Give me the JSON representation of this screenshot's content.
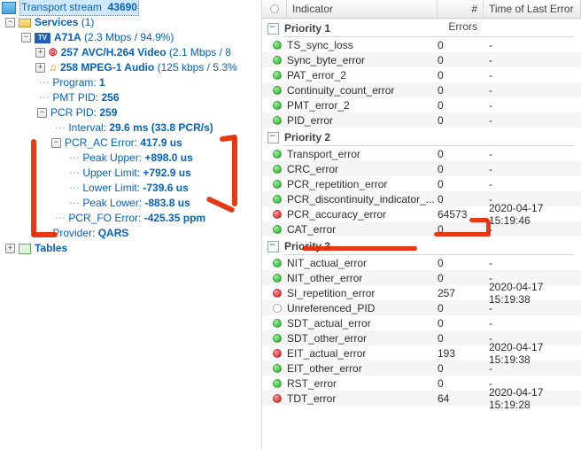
{
  "tree": {
    "transport_stream": {
      "label": "Transport stream",
      "id": "43690"
    },
    "services": {
      "label": "Services",
      "count": "(1)"
    },
    "channel": {
      "icon_text": "TV",
      "name": "A71A",
      "stats": "(2.3 Mbps / 94.9%)"
    },
    "video": {
      "pid": "257",
      "label": "AVC/H.264 Video",
      "stats": "(2.1 Mbps / 8"
    },
    "audio": {
      "pid": "258",
      "label": "MPEG-1 Audio",
      "stats": "(125 kbps / 5.3%"
    },
    "program": {
      "label": "Program:",
      "value": "1"
    },
    "pmt": {
      "label": "PMT PID:",
      "value": "256"
    },
    "pcr": {
      "label": "PCR PID:",
      "value": "259"
    },
    "interval": {
      "label": "Interval:",
      "value": "29.6 ms (33.8 PCR/s)"
    },
    "pcr_ac": {
      "label": "PCR_AC Error:",
      "value": "417.9 us"
    },
    "peak_upper": {
      "label": "Peak Upper:",
      "value": "+898.0 us"
    },
    "upper_limit": {
      "label": "Upper Limit:",
      "value": "+792.9 us"
    },
    "lower_limit": {
      "label": "Lower Limit:",
      "value": "-739.6 us"
    },
    "peak_lower": {
      "label": "Peak Lower:",
      "value": "-883.8 us"
    },
    "pcr_fo": {
      "label": "PCR_FO Error:",
      "value": "-425.35 ppm"
    },
    "provider": {
      "label": "Provider:",
      "value": "QARS"
    },
    "tables": {
      "label": "Tables"
    }
  },
  "table": {
    "headers": {
      "indicator": "Indicator",
      "errors": "# Errors",
      "time": "Time of Last Error"
    },
    "groups": [
      {
        "title": "Priority 1",
        "rows": [
          {
            "status": "green",
            "name": "TS_sync_loss",
            "errors": "0",
            "time": "-"
          },
          {
            "status": "green",
            "name": "Sync_byte_error",
            "errors": "0",
            "time": "-"
          },
          {
            "status": "green",
            "name": "PAT_error_2",
            "errors": "0",
            "time": "-"
          },
          {
            "status": "green",
            "name": "Continuity_count_error",
            "errors": "0",
            "time": "-"
          },
          {
            "status": "green",
            "name": "PMT_error_2",
            "errors": "0",
            "time": "-"
          },
          {
            "status": "green",
            "name": "PID_error",
            "errors": "0",
            "time": "-"
          }
        ]
      },
      {
        "title": "Priority 2",
        "rows": [
          {
            "status": "green",
            "name": "Transport_error",
            "errors": "0",
            "time": "-"
          },
          {
            "status": "green",
            "name": "CRC_error",
            "errors": "0",
            "time": "-"
          },
          {
            "status": "green",
            "name": "PCR_repetition_error",
            "errors": "0",
            "time": "-"
          },
          {
            "status": "green",
            "name": "PCR_discontinuity_indicator_...",
            "errors": "0",
            "time": "-"
          },
          {
            "status": "red",
            "name": "PCR_accuracy_error",
            "errors": "64573",
            "time": "2020-04-17 15:19:46"
          },
          {
            "status": "green",
            "name": "CAT_error",
            "errors": "0",
            "time": "-"
          }
        ]
      },
      {
        "title": "Priority 3",
        "rows": [
          {
            "status": "green",
            "name": "NIT_actual_error",
            "errors": "0",
            "time": "-"
          },
          {
            "status": "green",
            "name": "NIT_other_error",
            "errors": "0",
            "time": "-"
          },
          {
            "status": "red",
            "name": "SI_repetition_error",
            "errors": "257",
            "time": "2020-04-17 15:19:38"
          },
          {
            "status": "white",
            "name": "Unreferenced_PID",
            "errors": "0",
            "time": "-"
          },
          {
            "status": "green",
            "name": "SDT_actual_error",
            "errors": "0",
            "time": "-"
          },
          {
            "status": "green",
            "name": "SDT_other_error",
            "errors": "0",
            "time": "-"
          },
          {
            "status": "red",
            "name": "EIT_actual_error",
            "errors": "193",
            "time": "2020-04-17 15:19:38"
          },
          {
            "status": "green",
            "name": "EIT_other_error",
            "errors": "0",
            "time": "-"
          },
          {
            "status": "green",
            "name": "RST_error",
            "errors": "0",
            "time": "-"
          },
          {
            "status": "red",
            "name": "TDT_error",
            "errors": "64",
            "time": "2020-04-17 15:19:28"
          }
        ]
      }
    ]
  }
}
